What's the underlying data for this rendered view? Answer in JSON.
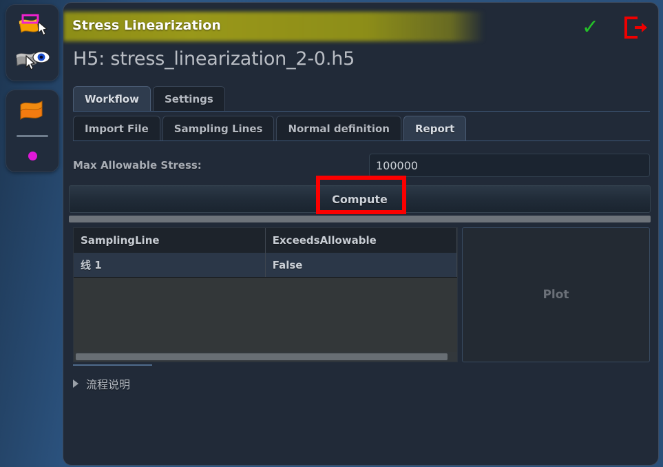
{
  "toolbar": {
    "groups": [
      {
        "name": "selection-group",
        "buttons": [
          {
            "icon": "surface-select-icon",
            "label": "Select surface"
          },
          {
            "icon": "surface-visibility-icon",
            "label": "Surface visibility"
          }
        ]
      },
      {
        "name": "display-group",
        "buttons": [
          {
            "icon": "surface-shape-icon",
            "label": "Surface shape"
          }
        ],
        "separator": true,
        "indicator": {
          "icon": "point-marker-icon",
          "color": "#e018d8"
        }
      }
    ]
  },
  "dialog": {
    "title": "Stress Linearization",
    "title_highlight_color": "#9a9a18",
    "actions": [
      {
        "name": "accept-icon",
        "icon": "check-icon",
        "label": "Accept",
        "color": "#24c028"
      },
      {
        "name": "exit-icon",
        "icon": "exit-icon",
        "label": "Exit",
        "color": "#ee0000"
      }
    ],
    "filename": "H5: stress_linearization_2-0.h5",
    "primary_tabs": [
      {
        "label": "Workflow",
        "active": true
      },
      {
        "label": "Settings",
        "active": false
      }
    ],
    "secondary_tabs": [
      {
        "label": "Import File",
        "active": false
      },
      {
        "label": "Sampling Lines",
        "active": false
      },
      {
        "label": "Normal definition",
        "active": false
      },
      {
        "label": "Report",
        "active": true
      }
    ],
    "form": {
      "stress_label": "Max Allowable Stress:",
      "stress_value": "100000",
      "stress_placeholder": "100000"
    },
    "compute": {
      "label": "Compute",
      "highlight_color": "#fc0000"
    },
    "table": {
      "columns": [
        "SamplingLine",
        "ExceedsAllowable"
      ],
      "rows": [
        [
          "线 1",
          "False"
        ]
      ]
    },
    "plot": {
      "label": "Plot"
    },
    "disclosure": {
      "arrow": "collapsed-triangle-icon",
      "label": "流程说明"
    }
  }
}
